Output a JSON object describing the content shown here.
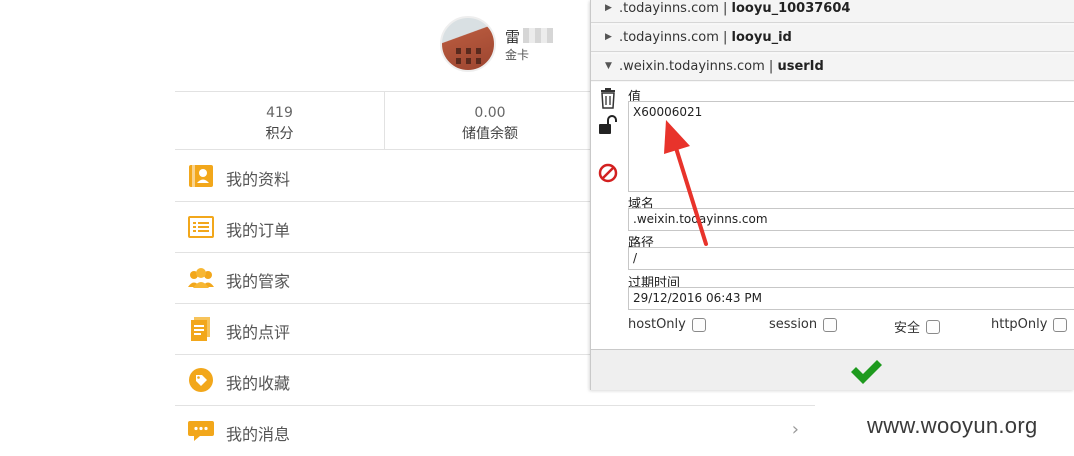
{
  "profile": {
    "name": "雷",
    "level": "金卡"
  },
  "stats": [
    {
      "value": "419",
      "label": "积分"
    },
    {
      "value": "0.00",
      "label": "储值余额"
    }
  ],
  "menu": [
    {
      "label": "我的资料",
      "icon": "profile-card-icon"
    },
    {
      "label": "我的订单",
      "icon": "order-list-icon"
    },
    {
      "label": "我的管家",
      "icon": "butler-people-icon"
    },
    {
      "label": "我的点评",
      "icon": "review-document-icon"
    },
    {
      "label": "我的收藏",
      "icon": "favorite-tag-icon"
    },
    {
      "label": "我的消息",
      "icon": "message-bubble-icon"
    }
  ],
  "cookies": [
    {
      "domain": ".todayinns.com",
      "name": "looyu_10037604"
    },
    {
      "domain": ".todayinns.com",
      "name": "looyu_id"
    },
    {
      "domain": ".weixin.todayinns.com",
      "name": "userId"
    }
  ],
  "editor": {
    "value_label": "值",
    "value": "X60006021",
    "domain_label": "域名",
    "domain": ".weixin.todayinns.com",
    "path_label": "路径",
    "path": "/",
    "expires_label": "过期时间",
    "expires": "29/12/2016 06:43 PM",
    "flags": [
      {
        "label": "hostOnly",
        "checked": false
      },
      {
        "label": "session",
        "checked": false
      },
      {
        "label": "安全",
        "checked": false
      },
      {
        "label": "httpOnly",
        "checked": false
      }
    ]
  },
  "separator": "|",
  "watermark": "www.wooyun.org",
  "colors": {
    "menu_icon": "#f2a71b",
    "arrow": "#e8332b",
    "save_check": "#1e9a1e",
    "delete_red": "#d32020"
  }
}
